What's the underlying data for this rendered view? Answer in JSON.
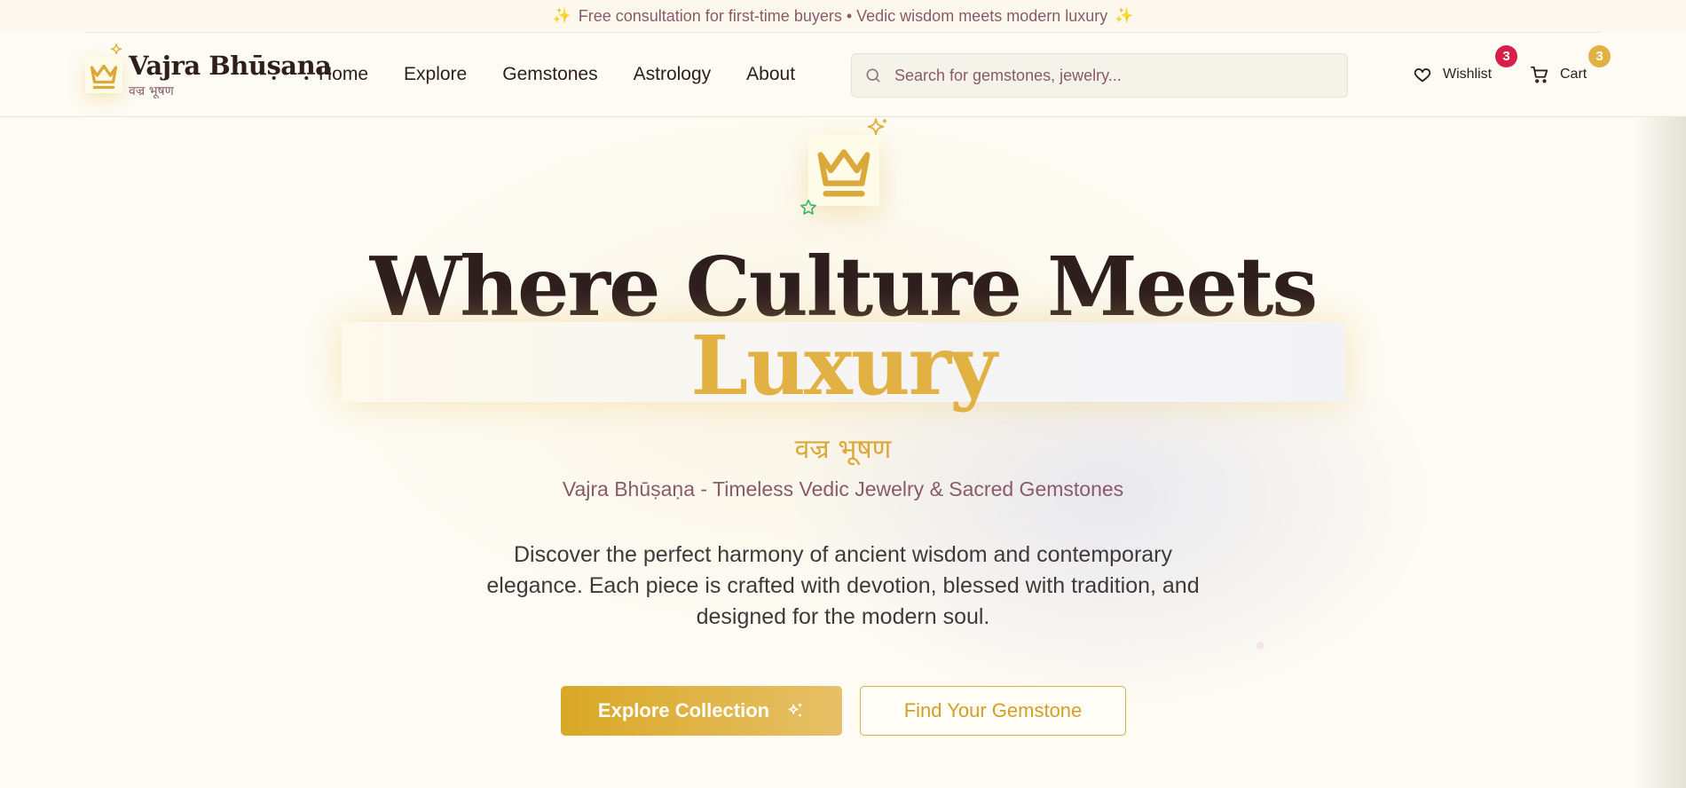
{
  "announcement": {
    "left_icon": "sparkles-icon",
    "text": "Free consultation for first-time buyers • Vedic wisdom meets modern luxury",
    "right_icon": "sparkles-icon"
  },
  "header": {
    "logo": {
      "icon": "crown-icon",
      "title": "Vajra Bhūṣaṇa",
      "subtitle": "वज्र भूषण"
    },
    "nav": [
      "Home",
      "Explore",
      "Gemstones",
      "Astrology",
      "About"
    ],
    "search": {
      "icon": "search-icon",
      "placeholder": "Search for gemstones, jewelry..."
    },
    "wishlist": {
      "icon": "heart-icon",
      "label": "Wishlist",
      "count": "3"
    },
    "cart": {
      "icon": "cart-icon",
      "label": "Cart",
      "count": "3"
    }
  },
  "hero": {
    "icon": "crown-icon",
    "headline": "Where Culture Meets",
    "highlight": "Luxury",
    "devanagari": "वज्र भूषण",
    "tagline": "Vajra Bhūṣaṇa - Timeless Vedic Jewelry & Sacred Gemstones",
    "description": "Discover the perfect harmony of ancient wisdom and contemporary elegance. Each piece is crafted with devotion, blessed with tradition, and designed for the modern soul.",
    "primary_button": "Explore Collection",
    "secondary_button": "Find Your Gemstone"
  },
  "colors": {
    "gold": "#dba93a",
    "dark": "#2e1e1e",
    "muted": "#8a5a6a",
    "wishlist_badge": "#d81f4a",
    "cart_badge": "#e2b144"
  }
}
